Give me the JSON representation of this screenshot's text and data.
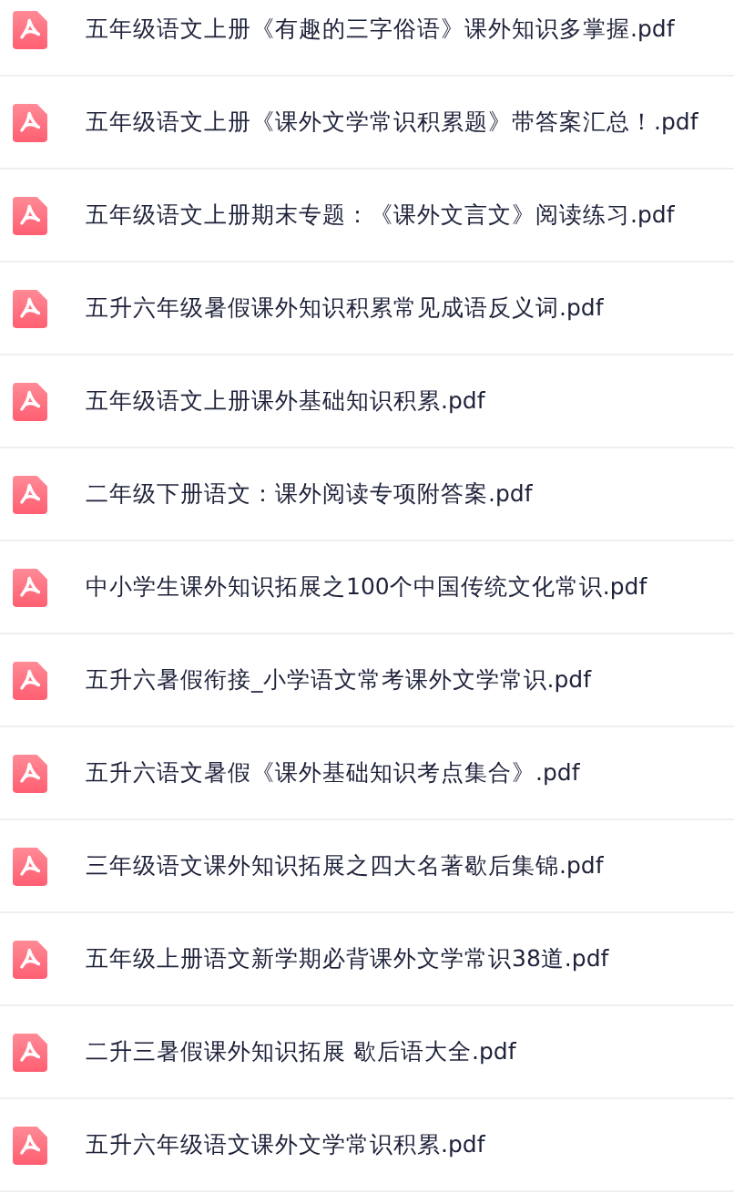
{
  "files": [
    {
      "name": "五年级语文上册《有趣的三字俗语》课外知识多掌握.pdf"
    },
    {
      "name": "五年级语文上册《课外文学常识积累题》带答案汇总！.pdf"
    },
    {
      "name": "五年级语文上册期末专题：《课外文言文》阅读练习.pdf"
    },
    {
      "name": "五升六年级暑假课外知识积累常见成语反义词.pdf"
    },
    {
      "name": "五年级语文上册课外基础知识积累.pdf"
    },
    {
      "name": "二年级下册语文：课外阅读专项附答案.pdf"
    },
    {
      "name": "中小学生课外知识拓展之100个中国传统文化常识.pdf"
    },
    {
      "name": "五升六暑假衔接_小学语文常考课外文学常识.pdf"
    },
    {
      "name": "五升六语文暑假《课外基础知识考点集合》.pdf"
    },
    {
      "name": "三年级语文课外知识拓展之四大名著歇后集锦.pdf"
    },
    {
      "name": "五年级上册语文新学期必背课外文学常识38道.pdf"
    },
    {
      "name": "二升三暑假课外知识拓展 歇后语大全.pdf"
    },
    {
      "name": "五升六年级语文课外文学常识积累.pdf"
    }
  ]
}
